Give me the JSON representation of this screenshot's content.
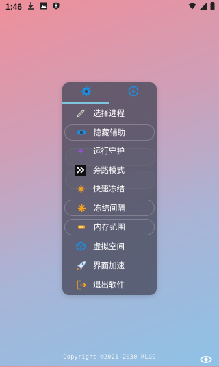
{
  "status_bar": {
    "time": "1:46",
    "icons": [
      "download-icon",
      "image-icon",
      "shield-icon"
    ],
    "right_icons": [
      "wifi-icon",
      "signal-icon",
      "battery-icon"
    ]
  },
  "panel": {
    "tabs": [
      {
        "icon": "gear-icon",
        "active": true
      },
      {
        "icon": "play-icon",
        "active": false
      }
    ],
    "items": [
      {
        "label": "选择进程",
        "icon": "pen-icon",
        "pill": false
      },
      {
        "label": "隐藏辅助",
        "icon": "eye-icon",
        "pill": true
      },
      {
        "label": "运行守护",
        "icon": "sparkle-icon",
        "pill": false
      },
      {
        "label": "旁路模式",
        "icon": "bypass-icon",
        "pill": false
      },
      {
        "label": "快速冻结",
        "icon": "snowflake-icon",
        "pill": false
      },
      {
        "label": "冻结间隔",
        "icon": "snowflake-icon",
        "pill": true
      },
      {
        "label": "内存范围",
        "icon": "memory-icon",
        "pill": true
      },
      {
        "label": "虚拟空间",
        "icon": "cube-icon",
        "pill": false
      },
      {
        "label": "界面加速",
        "icon": "rocket-icon",
        "pill": false
      },
      {
        "label": "退出软件",
        "icon": "exit-icon",
        "pill": false
      }
    ]
  },
  "footer": {
    "copyright": "Copyright ©2021-2030 RLGG",
    "icon": "eye-icon"
  },
  "colors": {
    "accent": "#1e8fe0",
    "indicator": "#7fc6dc",
    "warning_orange": "#f3a21c",
    "purple": "#9b4de0"
  }
}
